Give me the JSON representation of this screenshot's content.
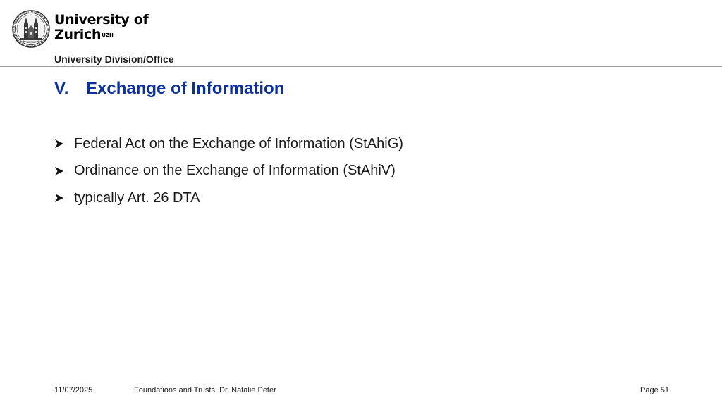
{
  "header": {
    "logo_icon": "university-seal-icon",
    "wordmark_line1": "University of",
    "wordmark_line2": "Zurich",
    "wordmark_sup": "UZH",
    "division": "University Division/Office"
  },
  "slide": {
    "title_number": "V.",
    "title": "Exchange of Information",
    "bullet_icon": "arrowhead-bullet-icon",
    "bullets": [
      "Federal Act on the Exchange of Information (StAhiG)",
      "Ordinance on the Exchange of Information (StAhiV)",
      "typically Art. 26 DTA"
    ]
  },
  "footer": {
    "date": "11/07/2025",
    "credit": "Foundations and Trusts, Dr. Natalie Peter",
    "page": "Page 51"
  },
  "colors": {
    "title": "#0a2f9e",
    "rule": "#9a9a9a",
    "text": "#1a1a1a"
  }
}
